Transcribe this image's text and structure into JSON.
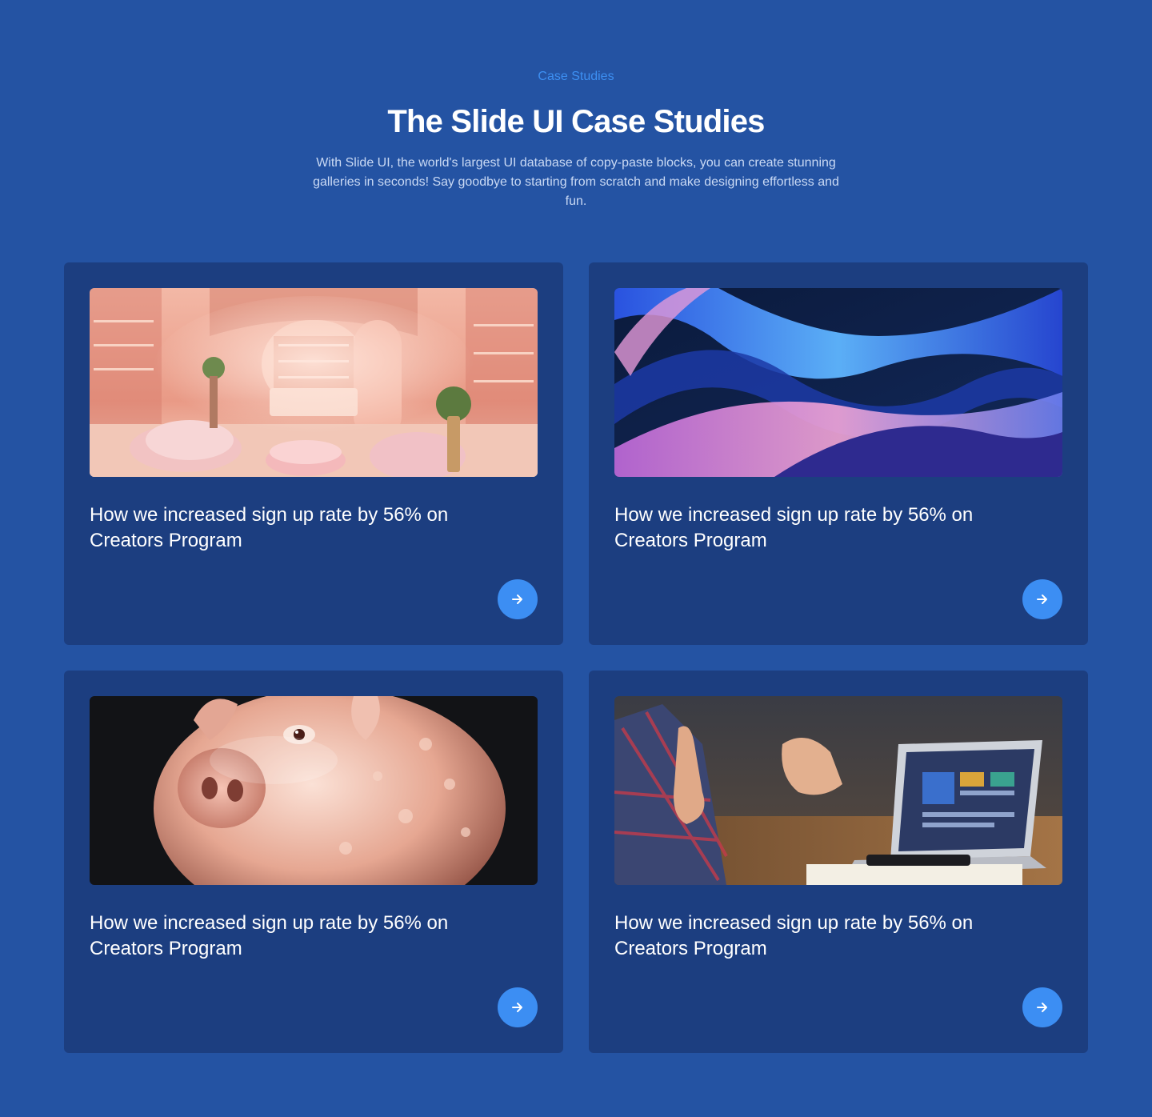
{
  "header": {
    "eyebrow": "Case Studies",
    "title": "The Slide UI Case Studies",
    "subtitle": "With Slide UI, the world's largest UI database of copy-paste blocks, you can create stunning galleries in seconds! Say goodbye to starting from scratch and make designing effortless and fun."
  },
  "cards": [
    {
      "title": "How we increased sign up rate by 56% on Creators Program",
      "image": "pink-boutique-interior",
      "action_icon": "arrow-right-icon"
    },
    {
      "title": "How we increased sign up rate by 56% on Creators Program",
      "image": "abstract-blue-waves",
      "action_icon": "arrow-right-icon"
    },
    {
      "title": "How we increased sign up rate by 56% on Creators Program",
      "image": "glass-piggy-bank",
      "action_icon": "arrow-right-icon"
    },
    {
      "title": "How we increased sign up rate by 56% on Creators Program",
      "image": "laptop-meeting-hands",
      "action_icon": "arrow-right-icon"
    }
  ],
  "colors": {
    "background": "#2453a3",
    "card": "#1c3e80",
    "accent": "#3c8ef3",
    "eyebrow": "#3d8ff2"
  }
}
